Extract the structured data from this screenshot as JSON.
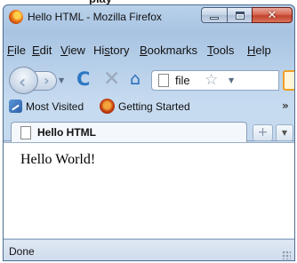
{
  "window": {
    "title": "Hello HTML - Mozilla Firefox",
    "minimize_glyph": "",
    "maximize_glyph": "",
    "close_glyph": "✕"
  },
  "menu": {
    "items": [
      {
        "label": "File",
        "access_key": "F"
      },
      {
        "label": "Edit",
        "access_key": "E"
      },
      {
        "label": "View",
        "access_key": "V"
      },
      {
        "label": "History",
        "access_key": "s"
      },
      {
        "label": "Bookmarks",
        "access_key": "B"
      },
      {
        "label": "Tools",
        "access_key": "T"
      },
      {
        "label": "Help",
        "access_key": "H"
      }
    ]
  },
  "navigation": {
    "back_icon": "‹",
    "forward_icon": "›",
    "history_dropdown": "▼",
    "reload_icon": "C",
    "stop_icon": "✕",
    "home_icon": "⌂",
    "url": "file",
    "bookmark_star": "☆",
    "url_dropdown": "▼"
  },
  "bookmarks": {
    "items": [
      {
        "label": "Most Visited",
        "icon": "most-visited-icon"
      },
      {
        "label": "Getting Started",
        "icon": "getting-started-icon"
      }
    ],
    "overflow": "»"
  },
  "tabs": {
    "items": [
      {
        "label": "Hello HTML",
        "selected": true
      }
    ],
    "new_tab": "+",
    "list_tabs": "▼"
  },
  "content": {
    "text": "Hello World!"
  },
  "status": {
    "text": "Done"
  },
  "caption": {
    "text": "play"
  },
  "colors": {
    "window_frame": "#b9d1ea",
    "close_button": "#c2432e",
    "reload_blue": "#2e78c4",
    "search_accent": "#f0a024"
  }
}
